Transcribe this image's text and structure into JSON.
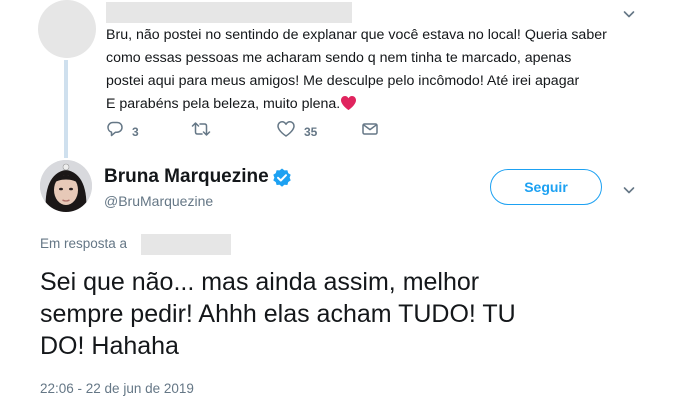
{
  "reply_tweet": {
    "text": "Bru, não postei no sentindo de explanar que você estava no local! Queria saber\ncomo essas pessoas me acharam sendo q nem tinha te marcado,  apenas\npostei aqui para meus amigos! Me desculpe pelo incômodo! Até irei apagar \nE parabéns pela beleza, muito plena.",
    "replies_count": "3",
    "retweets_count": "",
    "likes_count": "35"
  },
  "main_tweet": {
    "display_name": "Bruna Marquezine",
    "handle": "@BruMarquezine",
    "follow_label": "Seguir",
    "reply_prefix": "Em resposta a",
    "text": "Sei que não... mas ainda assim, melhor\nsempre pedir! Ahhh elas acham TUDO! TU\nDO! Hahaha",
    "timestamp": "22:06 - 22 de jun de 2019"
  },
  "colors": {
    "accent": "#1da1f2",
    "secondary_text": "#657786",
    "heart_emoji": "#e0245e"
  },
  "icons": [
    "chevron-down-icon",
    "reply-icon",
    "retweet-icon",
    "like-icon",
    "message-icon",
    "verified-badge-icon",
    "heart-emoji-icon"
  ]
}
